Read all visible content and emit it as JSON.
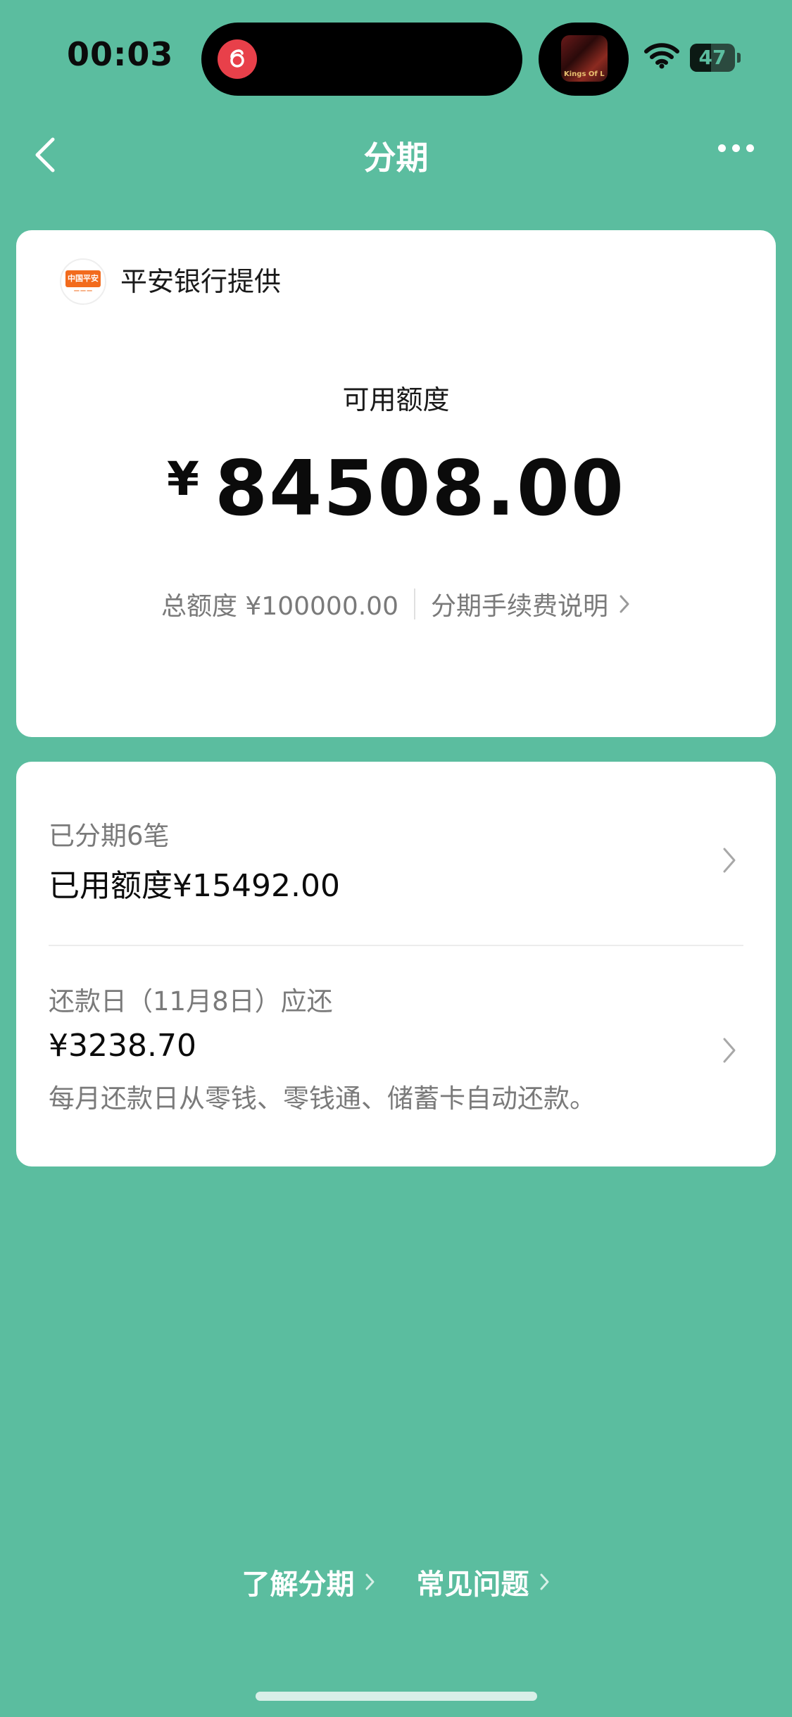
{
  "status_bar": {
    "time": "00:03",
    "battery": "47",
    "battery_level": 0.47,
    "now_playing_art_text": "Kings Of Leon"
  },
  "nav": {
    "title": "分期"
  },
  "provider_card": {
    "logo_text": "中国平安",
    "provider": "平安银行提供",
    "available_label": "可用额度",
    "currency": "¥",
    "available_amount": "84508.00",
    "total_label": "总额度 ¥100000.00",
    "fee_link": "分期手续费说明"
  },
  "installments": {
    "count_label": "已分期6笔",
    "used_label": "已用额度¥15492.00"
  },
  "repayment": {
    "due_label": "还款日（11月8日）应还",
    "amount": "¥3238.70",
    "note": "每月还款日从零钱、零钱通、储蓄卡自动还款。"
  },
  "footer": {
    "learn_link": "了解分期",
    "faq_link": "常见问题"
  },
  "colors": {
    "background": "#5bbd9f",
    "card": "#ffffff",
    "accent_logo": "#f26b1d",
    "music_app": "#e8404a"
  }
}
